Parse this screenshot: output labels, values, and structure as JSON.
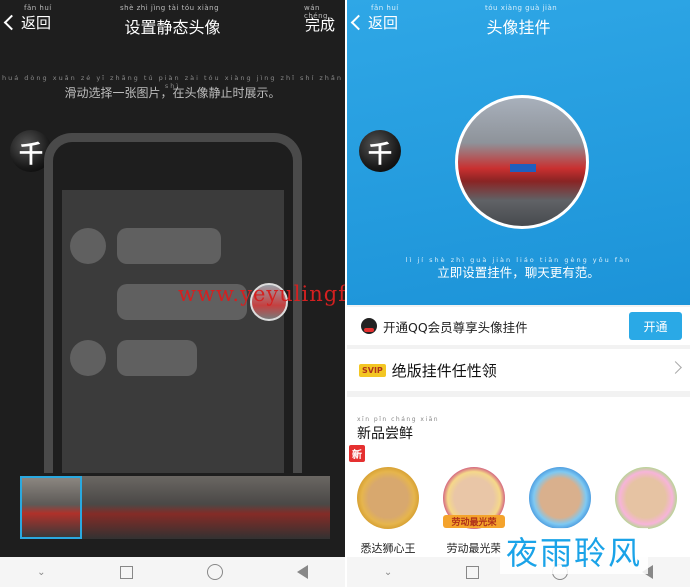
{
  "left": {
    "header": {
      "back_label": "返回",
      "back_py": "fǎn huí",
      "title": "设置静态头像",
      "title_py": "shè zhì jìng tài tóu xiàng",
      "done_label": "完成",
      "done_py": "wán chéng"
    },
    "hint": "滑动选择一张图片，在头像静止时展示。",
    "hint_py": "huá dòng xuǎn zé yī zhāng tú piàn zài tóu xiàng jìng zhǐ shí zhǎn shì",
    "avatar_glyph": "千",
    "watermark": "www.yeyulingfeng.com"
  },
  "right": {
    "header": {
      "back_label": "返回",
      "back_py": "fǎn huí",
      "title": "头像挂件",
      "title_py": "tóu xiàng guà jiàn"
    },
    "avatar_glyph": "千",
    "plate_text": "C 88088",
    "slogan": "立即设置挂件，聊天更有范。",
    "slogan_py": "lì jí shè zhì guà jiàn liáo tiān gèng yǒu fàn",
    "open_text": "开通QQ会员尊享头像挂件",
    "open_text_py": "kāi tōng huì yuán zūn xiǎng tóu xiàng guà jiàn",
    "open_button": "开通",
    "open_button_py": "kāi tōng",
    "svip_badge": "SVIP",
    "svip_text": "绝版挂件任性领",
    "svip_text_py": "jué bǎn guà jiàn rèn xìng lǐng",
    "new_title": "新品尝鲜",
    "new_title_py": "xīn pǐn cháng xiān",
    "new_tag": "新",
    "activity_badge": "劳动最光荣",
    "frames": [
      {
        "label": "悉达狮心王"
      },
      {
        "label": "劳动最光荣"
      },
      {
        "label": ""
      },
      {
        "label": ""
      }
    ]
  },
  "brand": {
    "logo": "夜雨聆风"
  },
  "colors": {
    "accent_blue": "#2aa9e6",
    "watermark_red": "#d42020",
    "dark_bg": "#1e1e1e"
  }
}
